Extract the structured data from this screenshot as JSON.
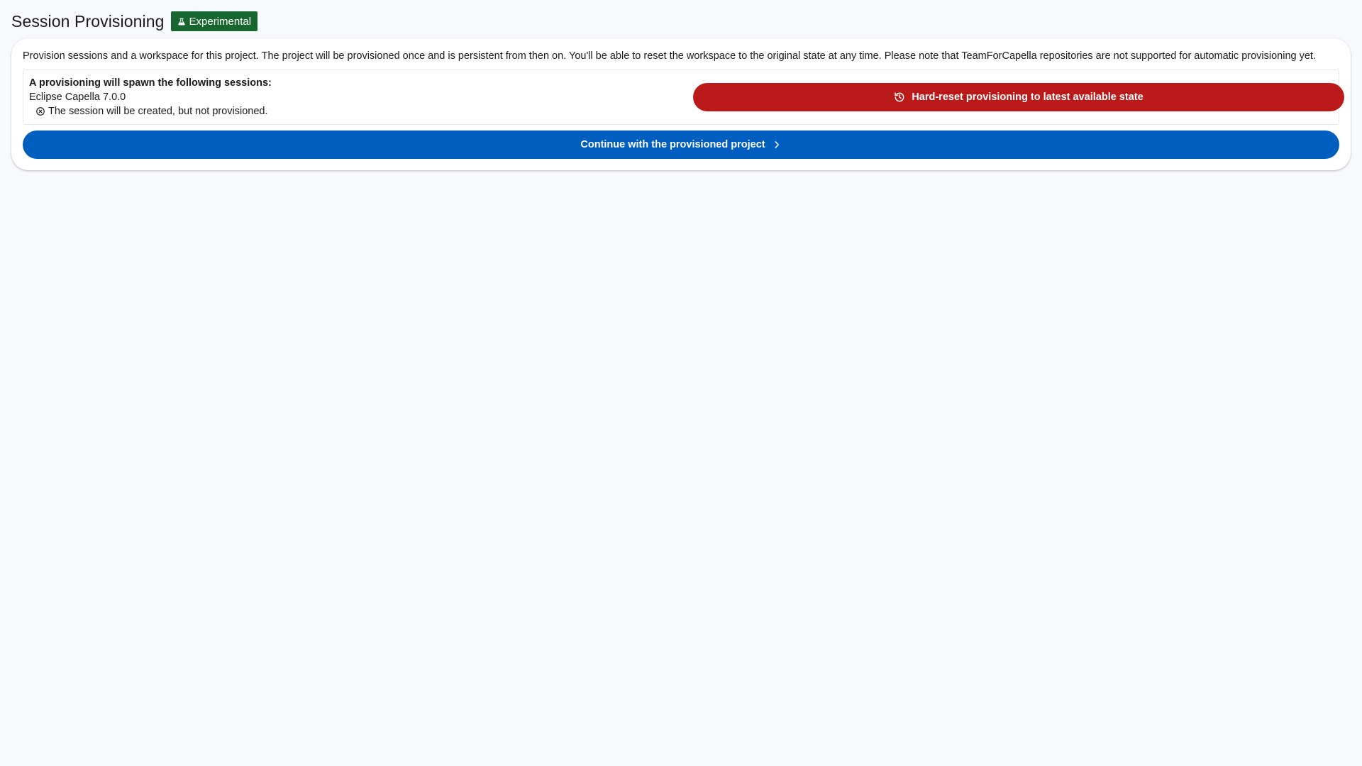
{
  "header": {
    "title": "Session Provisioning",
    "badge_label": "Experimental",
    "badge_icon": "flask-icon",
    "badge_color": "#18662f"
  },
  "card": {
    "description": "Provision sessions and a workspace for this project. The project will be provisioned once and is persistent from then on. You'll be able to reset the workspace to the original state at any time. Please note that TeamForCapella repositories are not supported for automatic provisioning yet.",
    "sessions": {
      "heading": "A provisioning will spawn the following sessions:",
      "items": [
        {
          "name": "Eclipse Capella 7.0.0",
          "status_icon": "cancel-circle-icon",
          "status_text": "The session will be created, but not provisioned."
        }
      ]
    },
    "reset_button": {
      "label": "Hard-reset provisioning to latest available state",
      "icon": "history-icon",
      "color": "#ba1a1a"
    },
    "continue_button": {
      "label": "Continue with the provisioned project",
      "icon": "chevron-right-icon",
      "color": "#005ebe"
    }
  }
}
